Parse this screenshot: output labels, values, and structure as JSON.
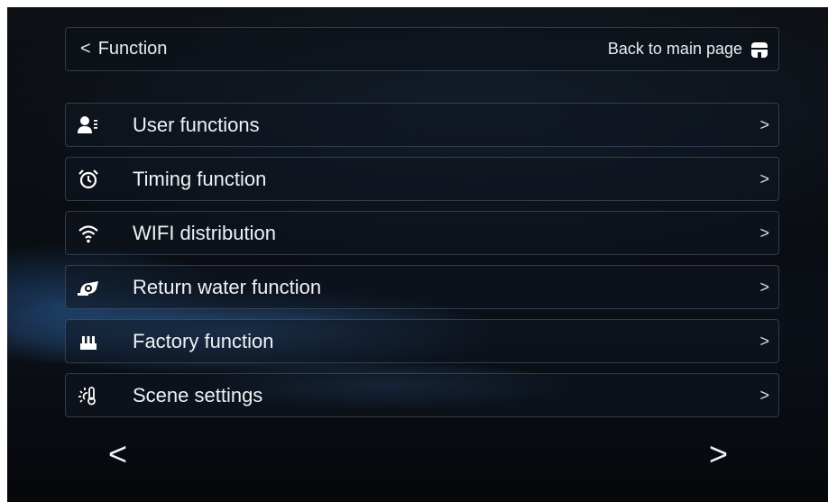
{
  "header": {
    "title": "Function",
    "back_chevron": "<",
    "back_main_label": "Back to main page",
    "home_icon": "home-icon"
  },
  "menu": {
    "items": [
      {
        "label": "User functions",
        "icon": "user-list-icon",
        "arrow": ">"
      },
      {
        "label": "Timing function",
        "icon": "alarm-clock-icon",
        "arrow": ">"
      },
      {
        "label": "WIFI distribution",
        "icon": "wifi-icon",
        "arrow": ">"
      },
      {
        "label": "Return water function",
        "icon": "water-pump-icon",
        "arrow": ">"
      },
      {
        "label": "Factory function",
        "icon": "factory-icon",
        "arrow": ">"
      },
      {
        "label": "Scene settings",
        "icon": "thermometer-sun-icon",
        "arrow": ">"
      }
    ]
  },
  "pager": {
    "prev": "<",
    "next": ">"
  },
  "colors": {
    "text": "#eef2f6",
    "border": "#6e8caa",
    "background": "#0a0d12"
  }
}
